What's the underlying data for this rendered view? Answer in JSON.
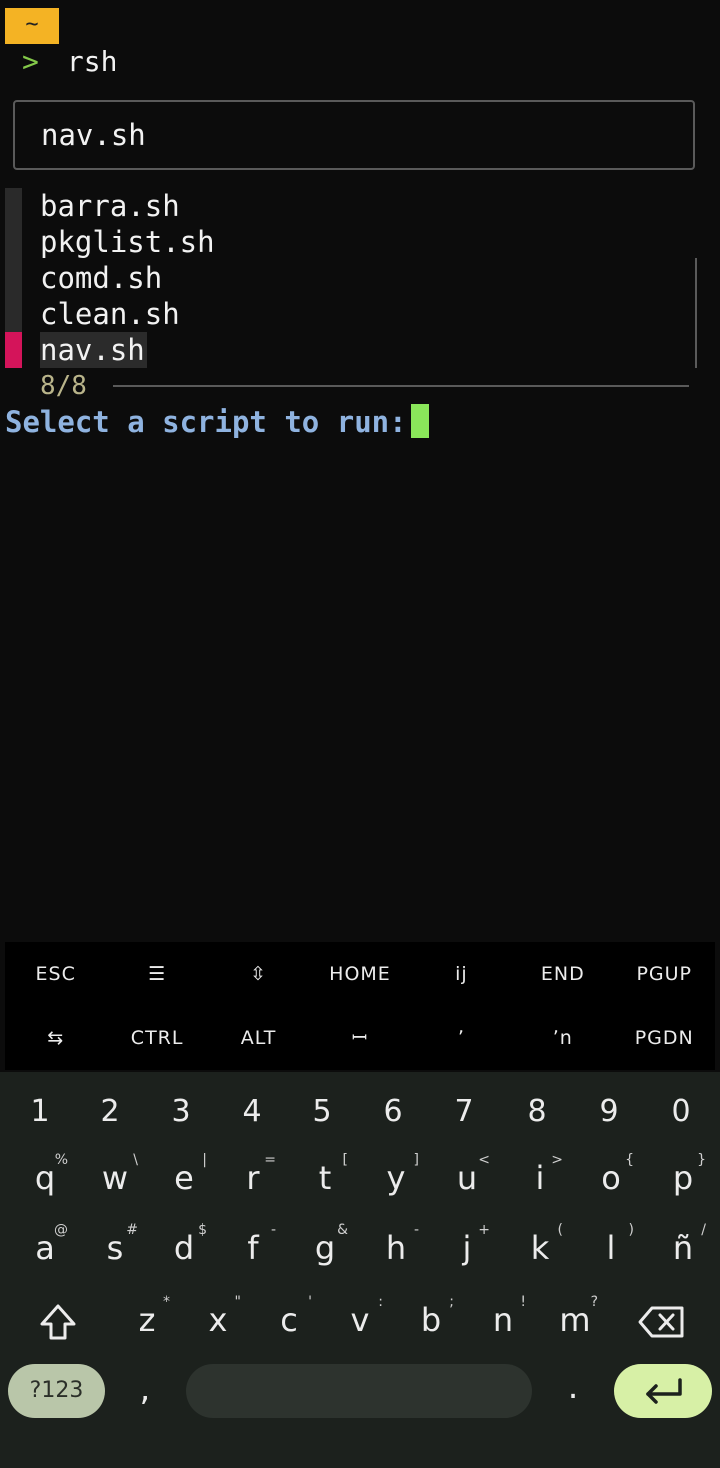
{
  "terminal": {
    "tilde": "~",
    "prompt_arrow": ">",
    "command": "rsh",
    "query": "nav.sh",
    "items": [
      {
        "label": "barra.sh",
        "selected": false
      },
      {
        "label": "pkglist.sh",
        "selected": false
      },
      {
        "label": "comd.sh",
        "selected": false
      },
      {
        "label": "clean.sh",
        "selected": false
      },
      {
        "label": "nav.sh",
        "selected": true
      }
    ],
    "count": "8/8",
    "select_prompt": "Select a script to run:"
  },
  "extra_keys": {
    "row1": [
      "ESC",
      "☰",
      "⇳",
      "HOME",
      "ij",
      "END",
      "PGUP"
    ],
    "row2": [
      "⇆",
      "CTRL",
      "ALT",
      "ꟷ",
      "ʼ",
      "ʼn",
      "PGDN"
    ]
  },
  "keyboard": {
    "numbers": [
      "1",
      "2",
      "3",
      "4",
      "5",
      "6",
      "7",
      "8",
      "9",
      "0"
    ],
    "row1": [
      [
        "q",
        "%"
      ],
      [
        "w",
        "\\"
      ],
      [
        "e",
        "|"
      ],
      [
        "r",
        "="
      ],
      [
        "t",
        "["
      ],
      [
        "y",
        "]"
      ],
      [
        "u",
        "<"
      ],
      [
        "i",
        ">"
      ],
      [
        "o",
        "{"
      ],
      [
        "p",
        "}"
      ]
    ],
    "row2": [
      [
        "a",
        "@"
      ],
      [
        "s",
        "#"
      ],
      [
        "d",
        "$"
      ],
      [
        "f",
        "-"
      ],
      [
        "g",
        "&"
      ],
      [
        "h",
        "-"
      ],
      [
        "j",
        "+"
      ],
      [
        "k",
        "("
      ],
      [
        "l",
        ")"
      ],
      [
        "ñ",
        "/"
      ]
    ],
    "row3": [
      [
        "z",
        "*"
      ],
      [
        "x",
        "\""
      ],
      [
        "c",
        "'"
      ],
      [
        "v",
        ":"
      ],
      [
        "b",
        ";"
      ],
      [
        "n",
        "!"
      ],
      [
        "m",
        "?"
      ]
    ],
    "num_switch": "?123",
    "comma": ",",
    "dot": "."
  }
}
